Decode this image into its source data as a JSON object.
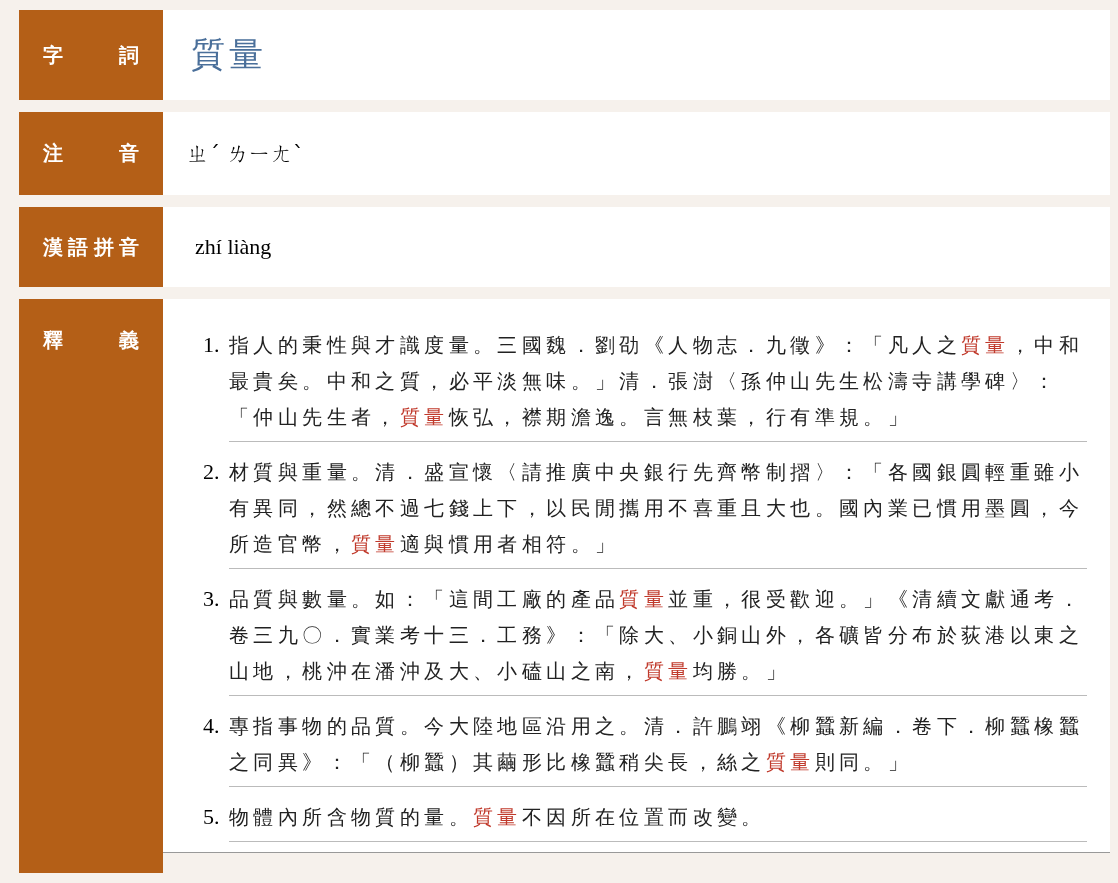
{
  "entry": {
    "label": "字詞",
    "word": "質量"
  },
  "zhuyin": {
    "label": "注音",
    "value": "ㄓˊ ㄌㄧㄤˋ"
  },
  "pinyin": {
    "label": "漢語拼音",
    "value": "zhí liàng"
  },
  "definitions": {
    "label": "釋義",
    "items": [
      {
        "number": "1.",
        "parts": [
          {
            "kind": "plain",
            "text": "指人的秉性與才識度量。三國魏．劉劭《人物志．九徵》：「凡人之"
          },
          {
            "kind": "term",
            "text": "質量"
          },
          {
            "kind": "plain",
            "text": "，中和最貴矣。中和之質，必平淡無味。」清．張澍〈孫仲山先生松濤寺講學碑〉：「仲山先生者，"
          },
          {
            "kind": "term",
            "text": "質量"
          },
          {
            "kind": "plain",
            "text": "恢弘，襟期澹逸。言無枝葉，行有準規。」"
          }
        ]
      },
      {
        "number": "2.",
        "parts": [
          {
            "kind": "plain",
            "text": "材質與重量。清．盛宣懷〈請推廣中央銀行先齊幣制摺〉：「各國銀圓輕重雖小有異同，然總不過七錢上下，以民閒攜用不喜重且大也。國內業已慣用墨圓，今所造官幣，"
          },
          {
            "kind": "term",
            "text": "質量"
          },
          {
            "kind": "plain",
            "text": "適與慣用者相符。」"
          }
        ]
      },
      {
        "number": "3.",
        "parts": [
          {
            "kind": "plain",
            "text": "品質與數量。如：「這間工廠的產品"
          },
          {
            "kind": "term",
            "text": "質量"
          },
          {
            "kind": "plain",
            "text": "並重，很受歡迎。」《清續文獻通考．卷三九〇．實業考十三．工務》：「除大、小銅山外，各礦皆分布於荻港以東之山地，桃沖在潘沖及大、小磕山之南，"
          },
          {
            "kind": "term",
            "text": "質量"
          },
          {
            "kind": "plain",
            "text": "均勝。」"
          }
        ]
      },
      {
        "number": "4.",
        "parts": [
          {
            "kind": "plain",
            "text": "專指事物的品質。今大陸地區沿用之。清．許鵬翊《柳蠶新編．卷下．柳蠶橡蠶之同異》：「（柳蠶）其繭形比橡蠶稍尖長，絲之"
          },
          {
            "kind": "term",
            "text": "質量"
          },
          {
            "kind": "plain",
            "text": "則同。」"
          }
        ]
      },
      {
        "number": "5.",
        "parts": [
          {
            "kind": "plain",
            "text": "物體內所含物質的量。"
          },
          {
            "kind": "term",
            "text": "質量"
          },
          {
            "kind": "plain",
            "text": "不因所在位置而改變。"
          }
        ]
      }
    ]
  }
}
